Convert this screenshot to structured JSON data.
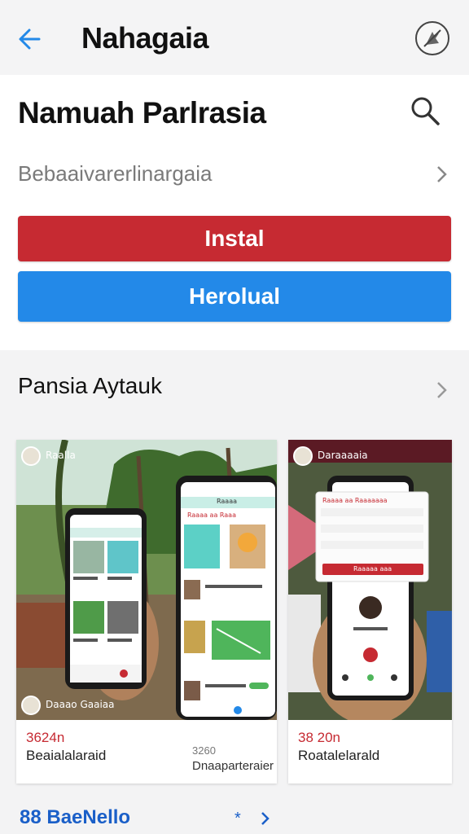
{
  "topbar": {
    "title": "Nahagaia"
  },
  "app": {
    "name": "Namuah Parlrasia",
    "subtitle": "Bebaaivarerlinargaia",
    "install_label": "Instal",
    "second_label": "Herolual"
  },
  "section": {
    "title": "Pansia Aytauk"
  },
  "screenshots": [
    {
      "header": "Raalla",
      "footer_name": "Daaao Gaaiaa",
      "label_top": "3624n",
      "label_bottom": "Beaialalaraid",
      "phone2_title": "Raaaa",
      "phone2_row": "Raaaa aa Raaa",
      "phone2_caption1": "3260",
      "phone2_caption2": "Dnaaparteraier"
    },
    {
      "header": "Daraaaaia",
      "label_top": "38 20n",
      "label_bottom": "Roatalelarald",
      "dialog_title": "Raaaa aa Raaaaaaa",
      "dialog_button": "Raaaaa aaa"
    }
  ],
  "bottom": {
    "label": "88 BaeNello",
    "star": "*"
  },
  "colors": {
    "accent_red": "#c62a32",
    "accent_blue": "#2389e8",
    "link_blue": "#1a5fc8"
  }
}
